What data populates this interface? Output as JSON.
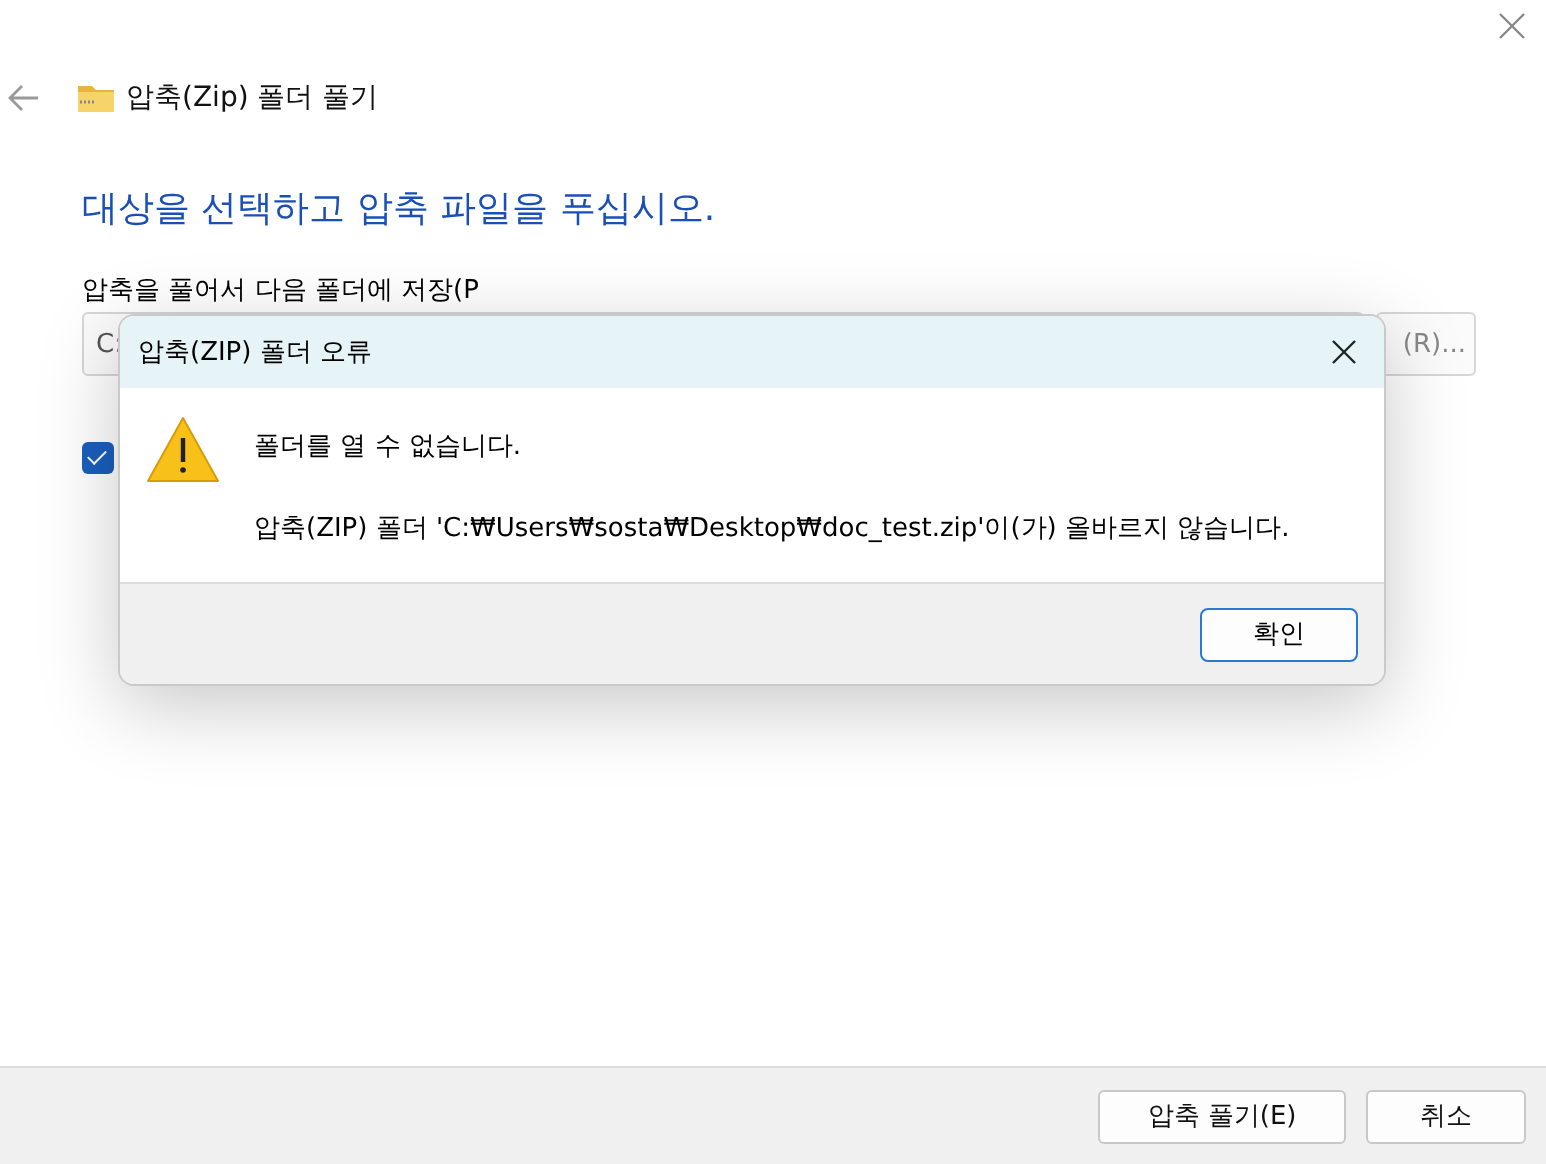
{
  "window": {
    "title": "압축(Zip) 폴더 풀기"
  },
  "heading": "대상을 선택하고 압축 파일을 푸십시오.",
  "destination": {
    "label": "압축을 풀어서 다음 폴더에 저장(P",
    "value": "C:",
    "browse_button": "(R)..."
  },
  "show_files_checkbox": {
    "checked": true
  },
  "footer_buttons": [
    {
      "label": "압축 풀기(E)",
      "kind": "primary"
    },
    {
      "label": "취소",
      "kind": "cancel"
    }
  ],
  "error_dialog": {
    "title": "압축(ZIP) 폴더 오류",
    "message": "폴더를 열 수 없습니다.",
    "detail": "압축(ZIP) 폴더 'C:₩Users₩sosta₩Desktop₩doc_test.zip'이(가) 올바르지 않습니다.",
    "button": "확인"
  }
}
